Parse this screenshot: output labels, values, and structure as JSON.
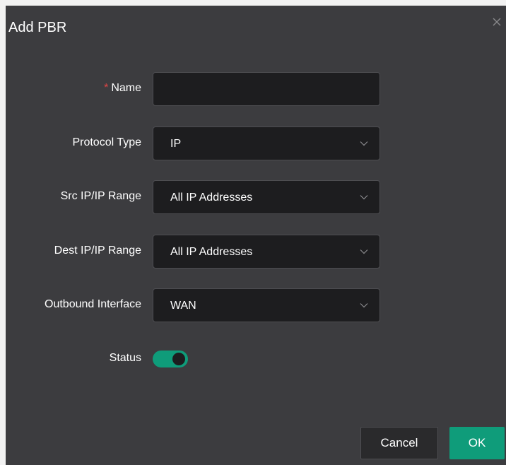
{
  "dialog": {
    "title": "Add PBR",
    "close_icon": "close-icon"
  },
  "form": {
    "name": {
      "label": "Name",
      "required_marker": "*",
      "value": ""
    },
    "protocol_type": {
      "label": "Protocol Type",
      "value": "IP"
    },
    "src_ip": {
      "label": "Src IP/IP Range",
      "value": "All IP Addresses"
    },
    "dest_ip": {
      "label": "Dest IP/IP Range",
      "value": "All IP Addresses"
    },
    "outbound_interface": {
      "label": "Outbound Interface",
      "value": "WAN"
    },
    "status": {
      "label": "Status",
      "enabled": true
    }
  },
  "footer": {
    "cancel_label": "Cancel",
    "ok_label": "OK"
  },
  "colors": {
    "accent": "#0f9c7a",
    "dialog_bg": "#3c3c3f",
    "field_bg": "#1d1d1f",
    "required": "#e04545"
  }
}
